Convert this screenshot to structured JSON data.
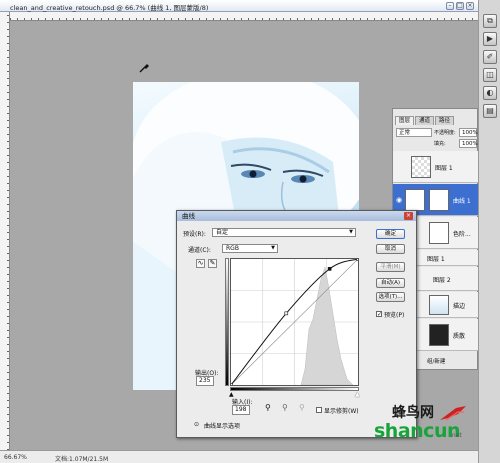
{
  "window": {
    "title": "clean_and_creative_retouch.psd @ 66.7% (曲线 1, 图层蒙版/8)",
    "zoom_status": "66.67%",
    "doc_status": "文档:1.07M/21.5M"
  },
  "layers_panel": {
    "tabs": [
      "图层",
      "通道",
      "路径"
    ],
    "blend_mode": "正常",
    "opacity_label": "不透明度:",
    "opacity": "100%",
    "fill_label": "填充:",
    "fill": "100%",
    "layers": [
      {
        "name": "图层 1"
      },
      {
        "name": "曲线 1"
      },
      {
        "name": "色阶..."
      },
      {
        "name": "图层 1"
      },
      {
        "name": "图层 2"
      },
      {
        "name": "描边"
      },
      {
        "name": "质散"
      }
    ],
    "footer": "组/新建"
  },
  "curves_dialog": {
    "title": "曲线",
    "preset_label": "预设(R):",
    "preset_value": "自定",
    "channel_label": "通道(C):",
    "channel_value": "RGB",
    "output_label": "输出(O):",
    "output_value": "235",
    "input_label": "输入(I):",
    "input_value": "198",
    "show_clipping_label": "显示修剪(W)",
    "display_options_label": "曲线显示选项",
    "buttons": {
      "ok": "确定",
      "cancel": "取消",
      "smooth": "平滑(M)",
      "auto": "自动(A)",
      "options": "选项(T)..."
    },
    "preview_label": "预览(P)",
    "preview_checked": true,
    "curve_points_input": [
      0,
      111,
      198,
      255
    ],
    "curve_points_output": [
      0,
      145,
      235,
      255
    ]
  },
  "watermark": {
    "cn": "蜂鸟网",
    "en": "shancun",
    "net": ".net"
  },
  "colors": {
    "selected_layer": "#3d6fd1",
    "watermark_green": "#1aa33c"
  }
}
